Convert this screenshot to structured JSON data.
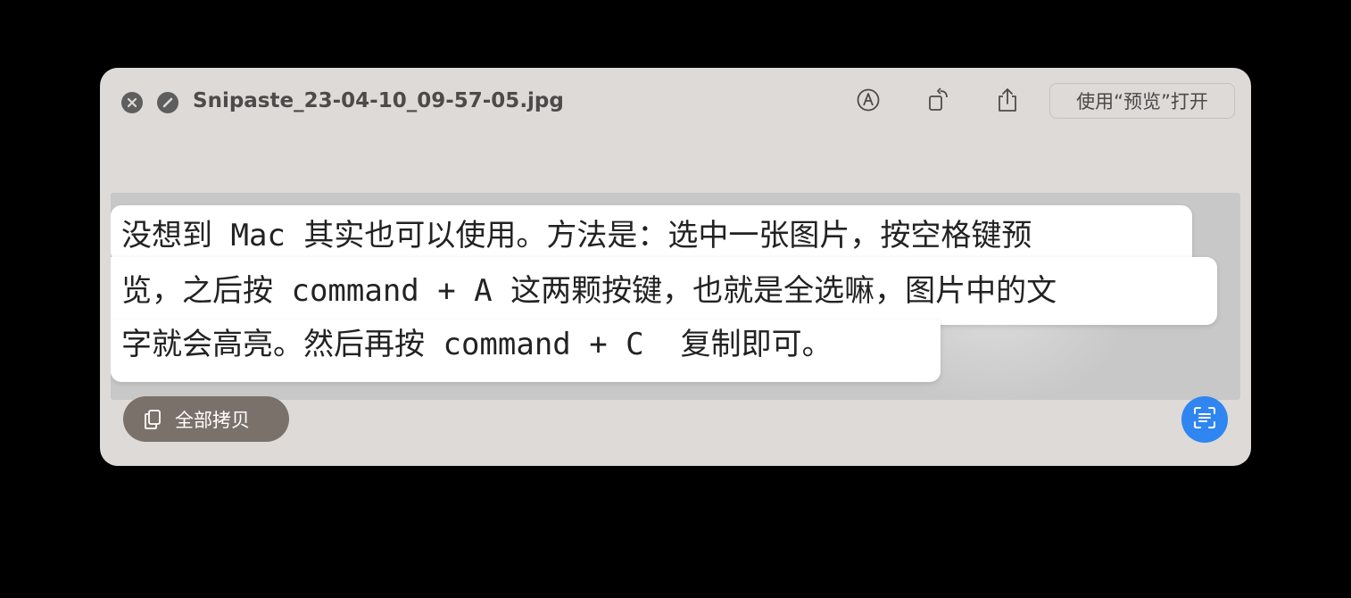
{
  "window": {
    "title": "Snipaste_23-04-10_09-57-05.jpg",
    "open_with_label": "使用“预览”打开"
  },
  "toolbar": {
    "icons": [
      "close-icon",
      "fullscreen-icon",
      "markup-icon",
      "rotate-icon",
      "share-icon"
    ]
  },
  "ocr_text": {
    "lines": [
      "没想到 Mac 其实也可以使用。方法是：选中一张图片，按空格键预",
      "览，之后按 command + A 这两颗按键，也就是全选嘛，图片中的文",
      "字就会高亮。然后再按 command + C  复制即可。"
    ]
  },
  "actions": {
    "copy_all_label": "全部拷贝"
  },
  "colors": {
    "window_bg": "#dedad8",
    "accent_blue": "#2f86f0",
    "copy_button_bg": "#7b716b"
  }
}
